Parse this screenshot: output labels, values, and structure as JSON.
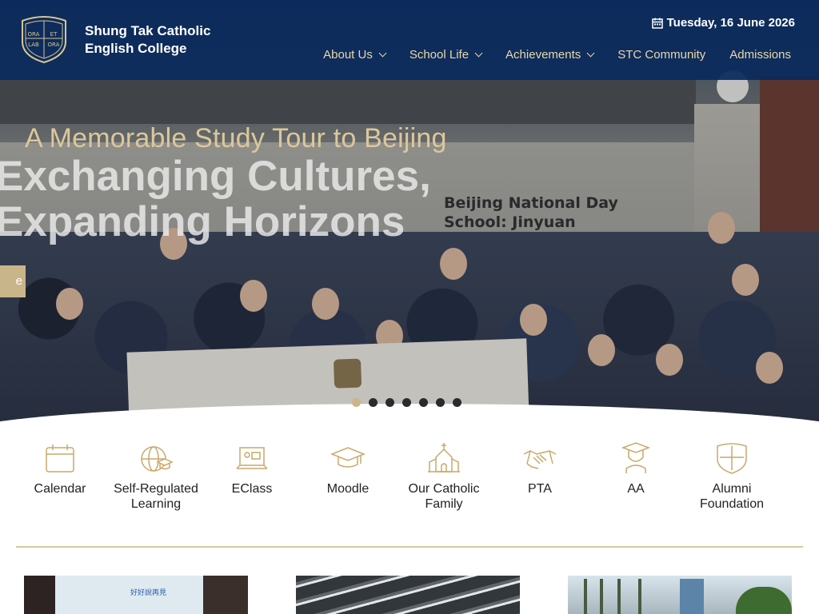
{
  "school": {
    "name_line1": "Shung Tak Catholic",
    "name_line2": "English College",
    "crest_words": [
      "ORA",
      "ET",
      "LAB",
      "ORA"
    ]
  },
  "header": {
    "date": "Tuesday, 16 June 2026"
  },
  "nav": [
    {
      "label": "About Us",
      "dropdown": true
    },
    {
      "label": "School Life",
      "dropdown": true
    },
    {
      "label": "Achievements",
      "dropdown": true
    },
    {
      "label": "STC Community",
      "dropdown": false
    },
    {
      "label": "Admissions",
      "dropdown": false
    }
  ],
  "hero": {
    "caption": "A Memorable Study Tour to Beijing",
    "headline": "Exchanging Cultures, Expanding Horizons",
    "button_label": "e",
    "sign_line1": "Beijing National Day",
    "sign_line2": "School: Jinyuan",
    "slide_count": 7,
    "active_slide": 1
  },
  "quick_links": [
    {
      "label": "Calendar",
      "icon": "calendar-icon"
    },
    {
      "label": "Self-Regulated Learning",
      "icon": "globe-graduation-icon"
    },
    {
      "label": "EClass",
      "icon": "laptop-chalkboard-icon"
    },
    {
      "label": "Moodle",
      "icon": "graduation-cap-icon"
    },
    {
      "label": "Our Catholic Family",
      "icon": "church-icon"
    },
    {
      "label": "PTA",
      "icon": "handshake-icon"
    },
    {
      "label": "AA",
      "icon": "alumni-graduate-icon"
    },
    {
      "label": "Alumni Foundation",
      "icon": "school-crest-icon"
    }
  ],
  "cards": [
    {
      "caption": "好好說再見"
    }
  ],
  "colors": {
    "header_bg": "#0a2a5c",
    "gold": "#c9b58a",
    "nav_text": "#e8d9a8",
    "divider": "#d6c9a4"
  }
}
